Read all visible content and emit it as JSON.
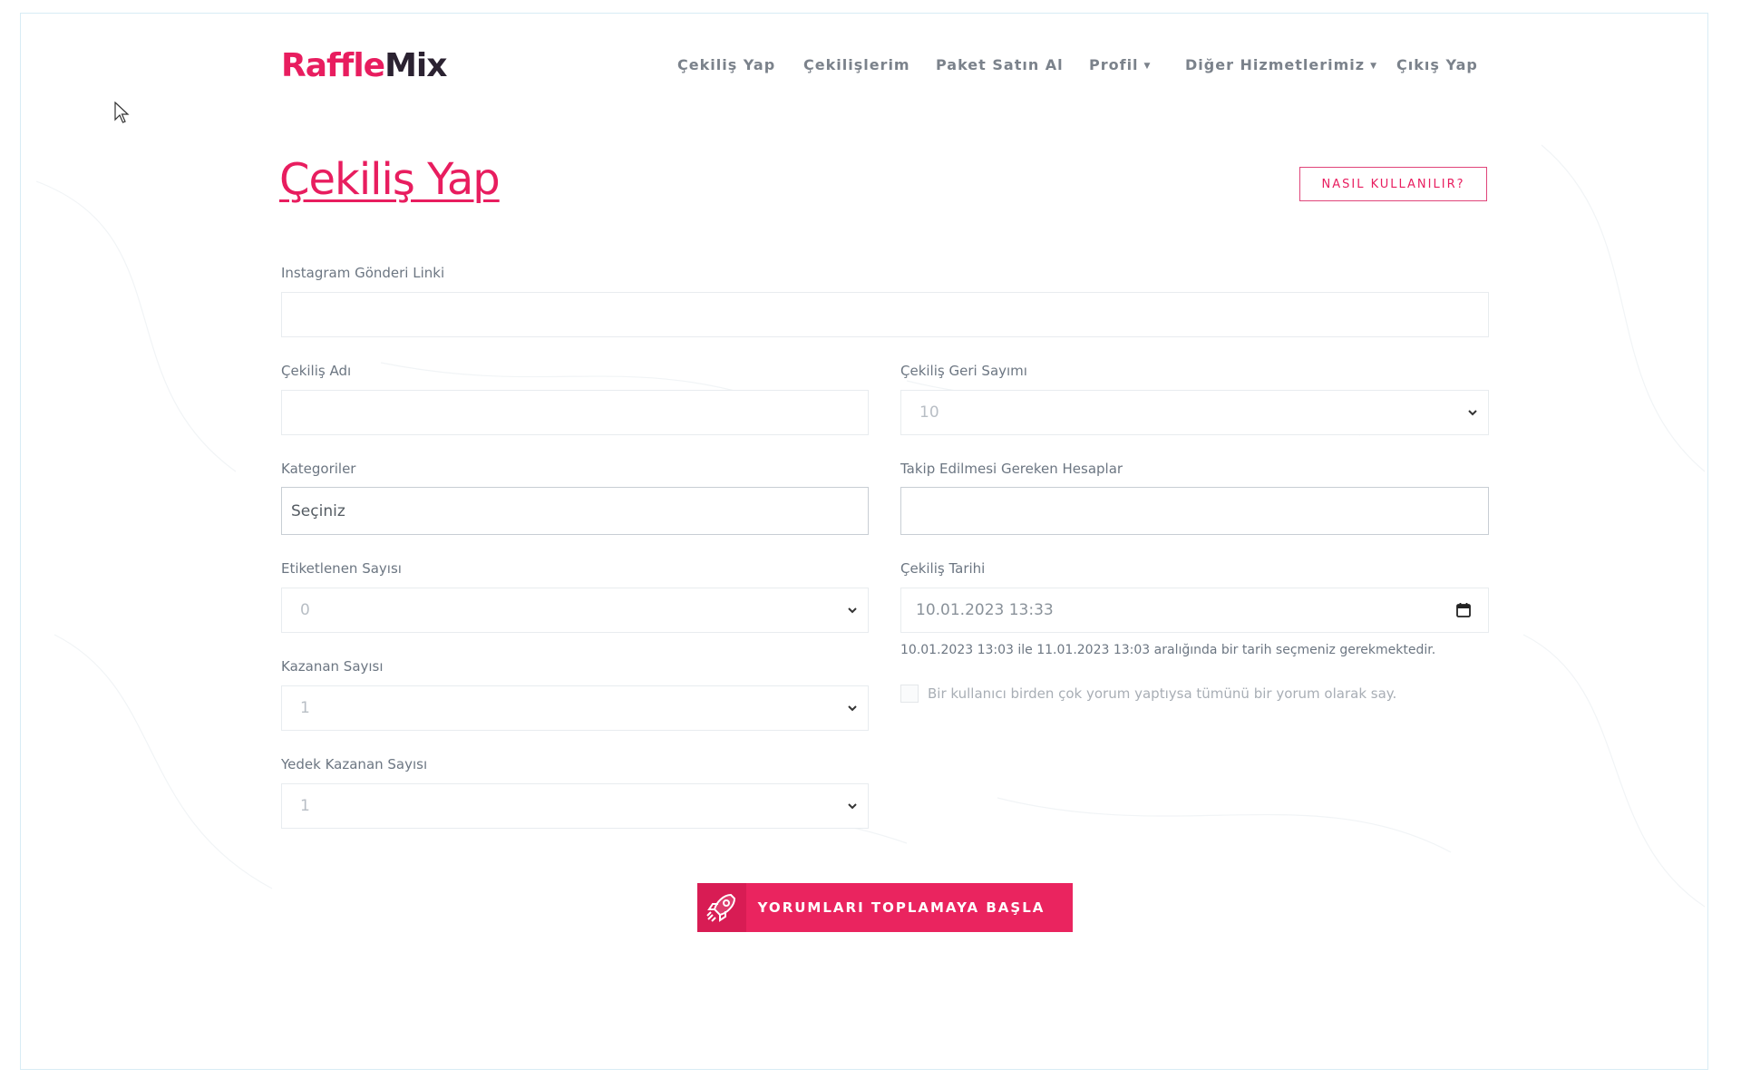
{
  "brand": {
    "part1": "Raffle",
    "part2": "Mix",
    "accent": "#e81d5f",
    "dark": "#2b2231"
  },
  "nav": {
    "items": [
      {
        "label": "Çekiliş Yap"
      },
      {
        "label": "Çekilişlerim"
      },
      {
        "label": "Paket Satın Al"
      },
      {
        "label": "Profil",
        "dropdown": true
      },
      {
        "label": "Diğer Hizmetlerimiz",
        "dropdown": true
      },
      {
        "label": "Çıkış Yap"
      }
    ]
  },
  "page": {
    "title": "Çekiliş Yap",
    "how_to_button": "NASIL KULLANILIR?"
  },
  "form": {
    "post_link": {
      "label": "Instagram Gönderi Linki",
      "value": ""
    },
    "raffle_name": {
      "label": "Çekiliş Adı",
      "value": ""
    },
    "countdown": {
      "label": "Çekiliş Geri Sayımı",
      "value": "10"
    },
    "categories": {
      "label": "Kategoriler",
      "value": "Seçiniz"
    },
    "follow_accounts": {
      "label": "Takip Edilmesi Gereken Hesaplar",
      "value": ""
    },
    "tagged_count": {
      "label": "Etiketlenen Sayısı",
      "value": "0"
    },
    "raffle_date": {
      "label": "Çekiliş Tarihi",
      "value": "10.01.2023 13:33",
      "hint": "10.01.2023 13:03 ile 11.01.2023 13:03 aralığında bir tarih seçmeniz gerekmektedir."
    },
    "winner_count": {
      "label": "Kazanan Sayısı",
      "value": "1"
    },
    "backup_winner_count": {
      "label": "Yedek Kazanan Sayısı",
      "value": "1"
    },
    "single_comment_checkbox": {
      "label": "Bir kullanıcı birden çok yorum yaptıysa tümünü bir yorum olarak say.",
      "checked": false
    },
    "submit_label": "YORUMLARI TOPLAMAYA BAŞLA"
  },
  "icons": {
    "cursor": "arrow-cursor-icon",
    "rocket": "rocket-icon",
    "chevron": "chevron-down-icon",
    "calendar": "calendar-icon"
  }
}
